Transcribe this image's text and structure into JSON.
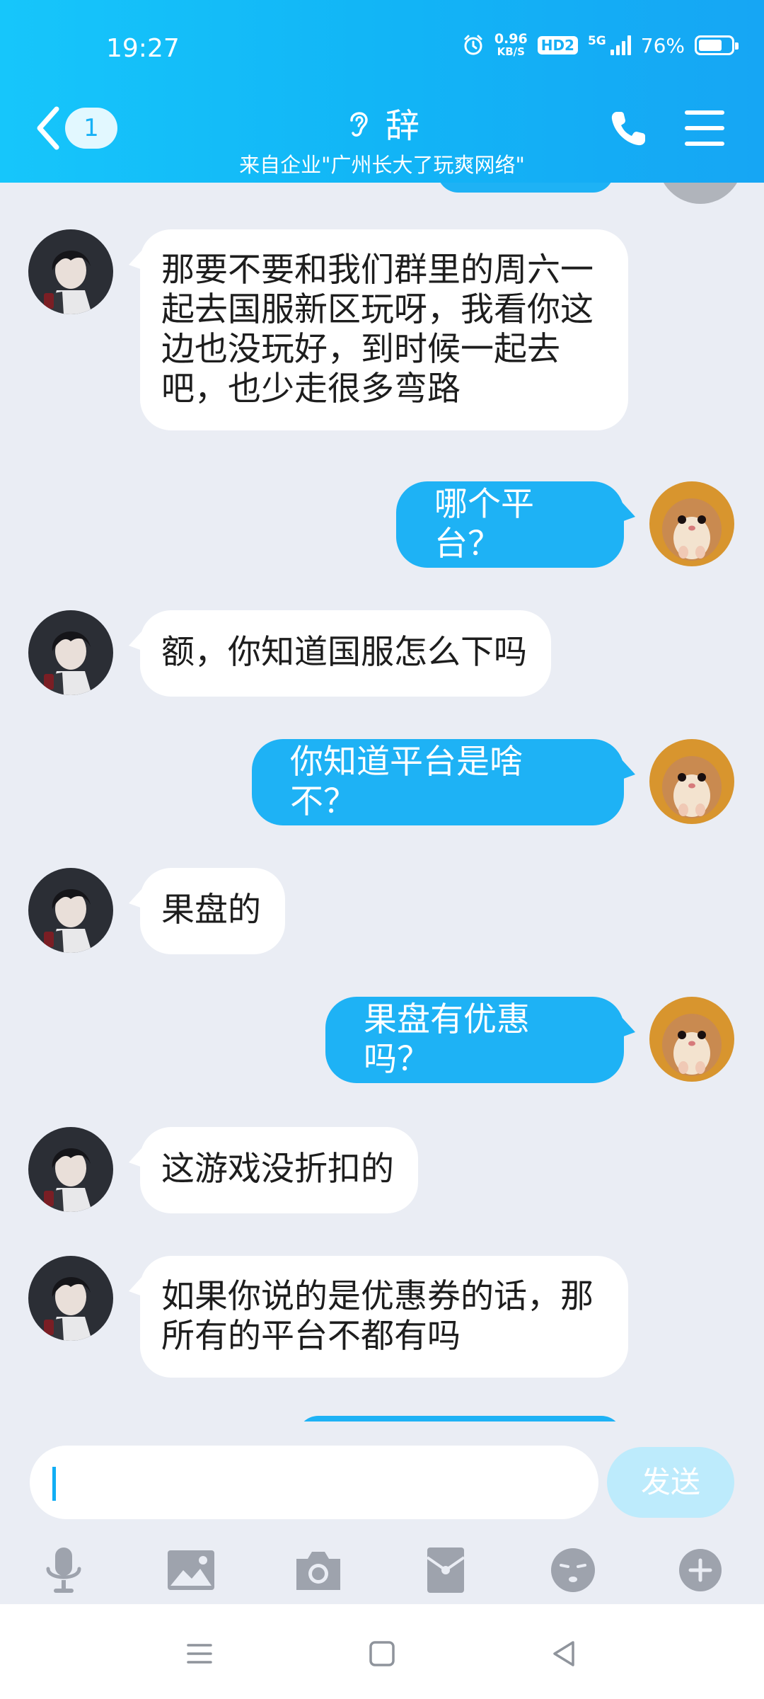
{
  "status_bar": {
    "time": "19:27",
    "net_speed_value": "0.96",
    "net_speed_unit": "KB/S",
    "hd_label": "HD2",
    "network_label": "5G",
    "battery_percent": "76%"
  },
  "header": {
    "back_badge_count": "1",
    "contact_name": "辞",
    "subtitle": "来自企业\"广州长大了玩爽网络\""
  },
  "messages": [
    {
      "side": "in",
      "text": "那要不要和我们群里的周六一起去国服新区玩呀，我看你这边也没玩好，到时候一起去吧，也少走很多弯路"
    },
    {
      "side": "out",
      "text": "哪个平台？"
    },
    {
      "side": "in",
      "text": "额，你知道国服怎么下吗"
    },
    {
      "side": "out",
      "text": "你知道平台是啥不？"
    },
    {
      "side": "in",
      "text": "果盘的"
    },
    {
      "side": "out",
      "text": "果盘有优惠吗？"
    },
    {
      "side": "in",
      "text": "这游戏没折扣的"
    },
    {
      "side": "in",
      "text": "如果你说的是优惠券的话，那所有的平台不都有吗"
    }
  ],
  "input": {
    "value": "",
    "send_label": "发送"
  },
  "toolbar": {
    "icons": [
      "microphone-icon",
      "image-icon",
      "camera-icon",
      "red-packet-icon",
      "emoji-icon",
      "plus-icon"
    ]
  },
  "navbar": {
    "icons": [
      "menu-icon",
      "home-icon",
      "back-icon"
    ]
  },
  "colors": {
    "header": "#12b5f6",
    "outgoing_bubble": "#1eb2f5",
    "incoming_bubble": "#ffffff",
    "background": "#eaedf4"
  }
}
